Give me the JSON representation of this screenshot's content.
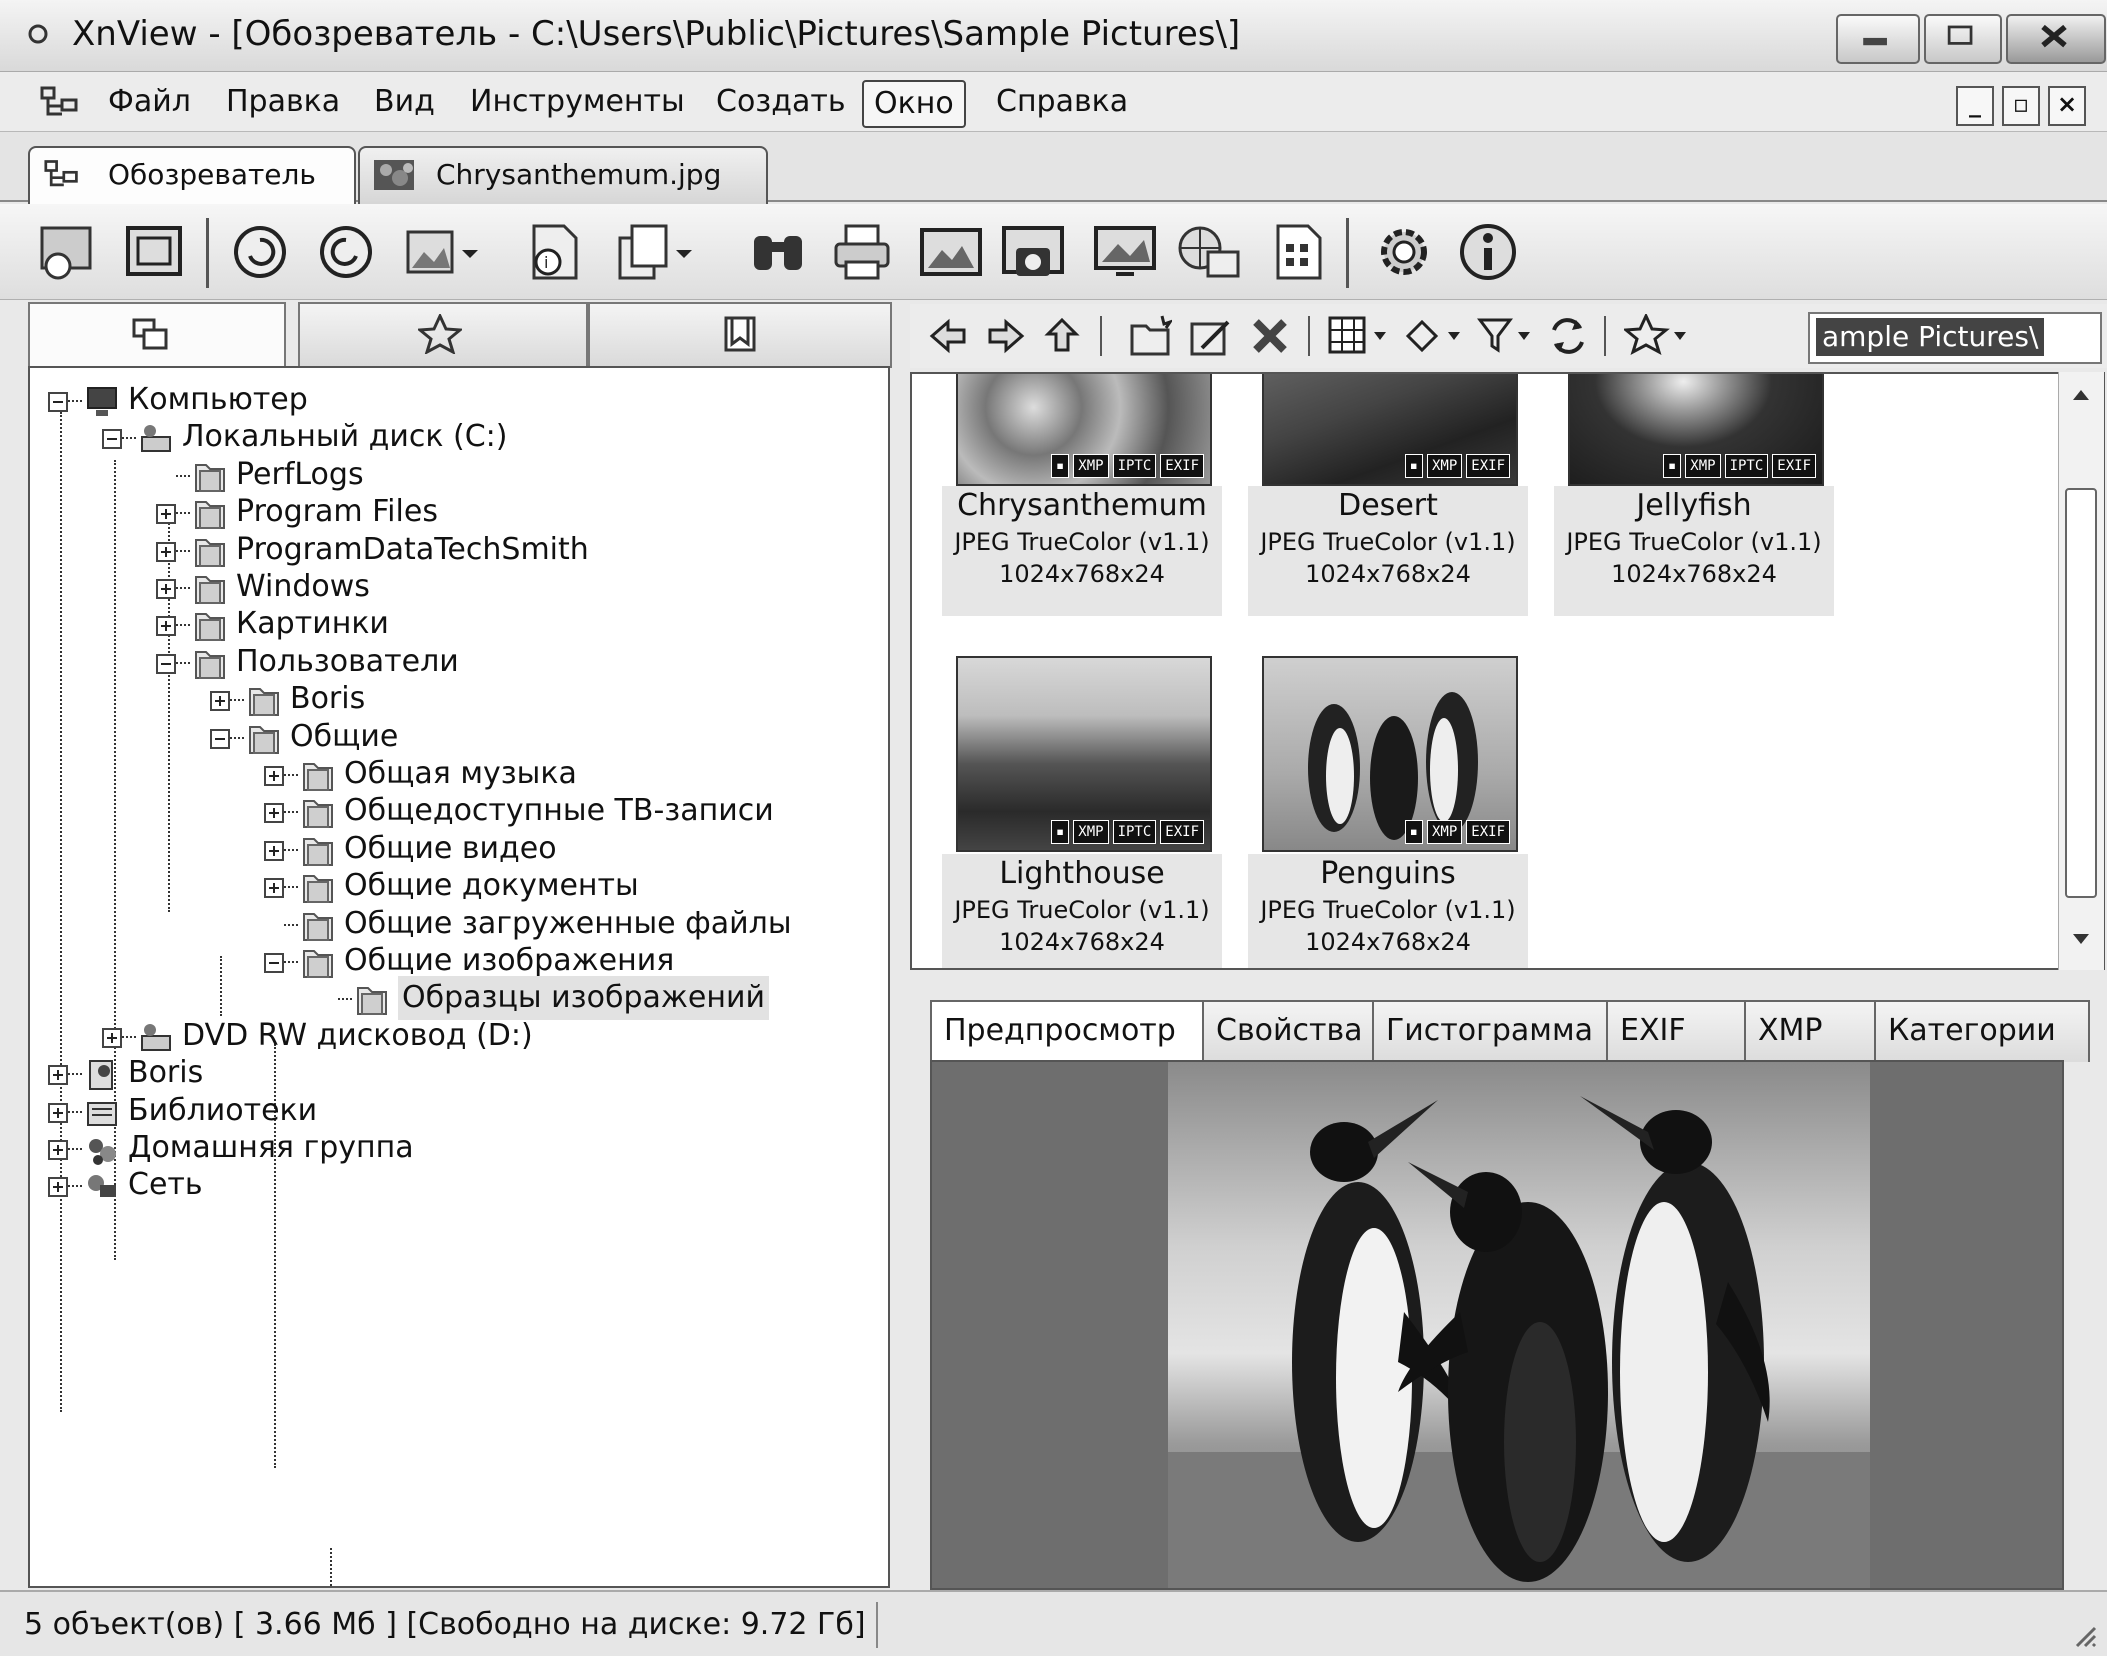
{
  "window": {
    "title": "XnView - [Обозреватель - C:\\Users\\Public\\Pictures\\Sample Pictures\\]"
  },
  "menu": {
    "items": [
      "Файл",
      "Правка",
      "Вид",
      "Инструменты",
      "Создать",
      "Окно",
      "Справка"
    ],
    "active": "Окно"
  },
  "doc_tabs": [
    {
      "label": "Обозреватель",
      "active": true,
      "icon": "browser-tree-icon"
    },
    {
      "label": "Chrysanthemum.jpg",
      "active": false,
      "icon": "image-thumbnail-icon"
    }
  ],
  "toolbar": {
    "icons": [
      "open-browser-icon",
      "fullscreen-icon",
      "rotate-left-icon",
      "rotate-right-icon",
      "convert-icon",
      "info-page-icon",
      "copy-icon",
      "find-icon",
      "print-icon",
      "slideshow-icon",
      "capture-icon",
      "screen-icon",
      "web-icon",
      "batch-icon",
      "settings-icon",
      "about-icon"
    ]
  },
  "left_panel": {
    "tabs": [
      "folders-icon",
      "favorites-icon",
      "categories-icon"
    ],
    "tree": [
      {
        "label": "Компьютер",
        "depth": 0,
        "expander": "minus",
        "icon": "computer-icon"
      },
      {
        "label": "Локальный диск (C:)",
        "depth": 1,
        "expander": "minus",
        "icon": "drive-icon"
      },
      {
        "label": "PerfLogs",
        "depth": 2,
        "expander": "none",
        "icon": "folder-icon"
      },
      {
        "label": "Program Files",
        "depth": 2,
        "expander": "plus",
        "icon": "folder-icon"
      },
      {
        "label": "ProgramDataTechSmith",
        "depth": 2,
        "expander": "plus",
        "icon": "folder-icon"
      },
      {
        "label": "Windows",
        "depth": 2,
        "expander": "plus",
        "icon": "folder-icon"
      },
      {
        "label": "Картинки",
        "depth": 2,
        "expander": "plus",
        "icon": "folder-icon"
      },
      {
        "label": "Пользователи",
        "depth": 2,
        "expander": "minus",
        "icon": "folder-icon"
      },
      {
        "label": "Boris",
        "depth": 3,
        "expander": "plus",
        "icon": "folder-icon"
      },
      {
        "label": "Общие",
        "depth": 3,
        "expander": "minus",
        "icon": "folder-icon"
      },
      {
        "label": "Общая музыка",
        "depth": 4,
        "expander": "plus",
        "icon": "folder-icon"
      },
      {
        "label": "Общедоступные ТВ-записи",
        "depth": 4,
        "expander": "plus",
        "icon": "folder-icon"
      },
      {
        "label": "Общие видео",
        "depth": 4,
        "expander": "plus",
        "icon": "folder-icon"
      },
      {
        "label": "Общие документы",
        "depth": 4,
        "expander": "plus",
        "icon": "folder-icon"
      },
      {
        "label": "Общие загруженные файлы",
        "depth": 4,
        "expander": "none",
        "icon": "folder-icon"
      },
      {
        "label": "Общие изображения",
        "depth": 4,
        "expander": "minus",
        "icon": "folder-icon"
      },
      {
        "label": "Образцы изображений",
        "depth": 5,
        "expander": "none",
        "icon": "folder-icon",
        "selected": true
      },
      {
        "label": "DVD RW дисковод (D:)",
        "depth": 1,
        "expander": "plus",
        "icon": "dvd-drive-icon"
      },
      {
        "label": "Boris",
        "depth": 0,
        "expander": "plus",
        "icon": "user-folder-icon"
      },
      {
        "label": "Библиотеки",
        "depth": 0,
        "expander": "plus",
        "icon": "libraries-icon"
      },
      {
        "label": "Домашняя группа",
        "depth": 0,
        "expander": "plus",
        "icon": "homegroup-icon"
      },
      {
        "label": "Сеть",
        "depth": 0,
        "expander": "plus",
        "icon": "network-icon"
      }
    ]
  },
  "browser_toolbar": {
    "path": "ample Pictures\\",
    "icons": [
      "back-arrow-icon",
      "forward-arrow-icon",
      "up-folder-icon",
      "new-folder-icon",
      "rename-icon",
      "delete-icon",
      "view-mode-icon",
      "sort-icon",
      "filter-icon",
      "refresh-icon",
      "favorite-star-icon"
    ]
  },
  "thumbnails": [
    {
      "name": "Chrysanthemum",
      "format": "JPEG TrueColor (v1.1)",
      "dims": "1024x768x24",
      "badges": [
        "XMP",
        "IPTC",
        "EXIF"
      ]
    },
    {
      "name": "Desert",
      "format": "JPEG TrueColor (v1.1)",
      "dims": "1024x768x24",
      "badges": [
        "XMP",
        "EXIF"
      ]
    },
    {
      "name": "Jellyfish",
      "format": "JPEG TrueColor (v1.1)",
      "dims": "1024x768x24",
      "badges": [
        "XMP",
        "IPTC",
        "EXIF"
      ]
    },
    {
      "name": "Lighthouse",
      "format": "JPEG TrueColor (v1.1)",
      "dims": "1024x768x24",
      "badges": [
        "XMP",
        "IPTC",
        "EXIF"
      ]
    },
    {
      "name": "Penguins",
      "format": "JPEG TrueColor (v1.1)",
      "dims": "1024x768x24",
      "badges": [
        "XMP",
        "EXIF"
      ]
    }
  ],
  "info_tabs": [
    "Предпросмотр",
    "Свойства",
    "Гистограмма",
    "EXIF",
    "XMP",
    "Категории"
  ],
  "info_active": "Предпросмотр",
  "status": {
    "text": "5 объект(ов) [ 3.66 Мб ] [Свободно на диске: 9.72 Гб]"
  }
}
